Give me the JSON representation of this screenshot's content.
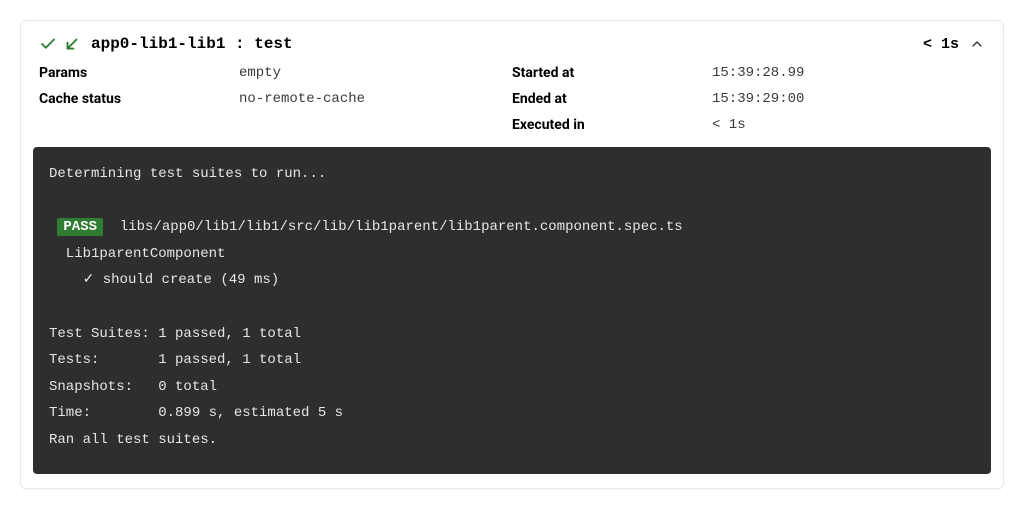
{
  "header": {
    "title": "app0-lib1-lib1 : test",
    "duration": "< 1s"
  },
  "meta": {
    "params_label": "Params",
    "params_value": "empty",
    "cache_label": "Cache status",
    "cache_value": "no-remote-cache",
    "started_label": "Started at",
    "started_value": "15:39:28.99",
    "ended_label": "Ended at",
    "ended_value": "15:39:29:00",
    "executed_label": "Executed in",
    "executed_value": "< 1s"
  },
  "terminal": {
    "line_determining": "Determining test suites to run...",
    "pass_badge": "PASS",
    "pass_file": "  libs/app0/lib1/lib1/src/lib/lib1parent/lib1parent.component.spec.ts",
    "line_component": "  Lib1parentComponent",
    "line_should": "    ✓ should create (49 ms)",
    "line_suites": "Test Suites: 1 passed, 1 total",
    "line_tests": "Tests:       1 passed, 1 total",
    "line_snapshots": "Snapshots:   0 total",
    "line_time": "Time:        0.899 s, estimated 5 s",
    "line_ran": "Ran all test suites."
  }
}
